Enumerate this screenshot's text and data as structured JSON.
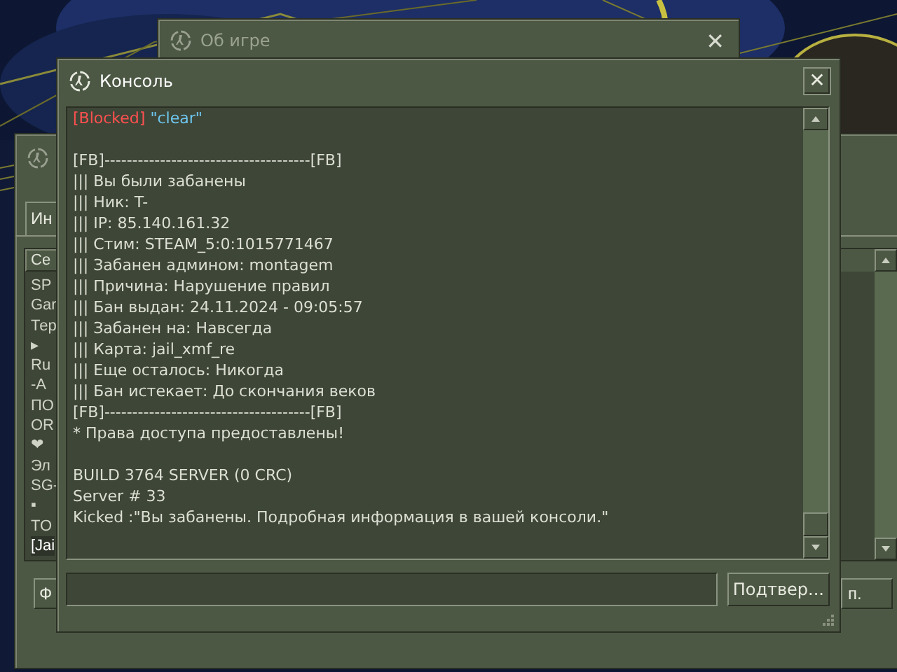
{
  "server_window": {
    "tab": "Ин",
    "column_header": "Се",
    "rows": [
      {
        "text": "SP",
        "selected": false
      },
      {
        "text": "Gar",
        "selected": false
      },
      {
        "text": "Тер",
        "selected": false
      },
      {
        "text": "▸",
        "selected": false
      },
      {
        "text": "Ru",
        "selected": false
      },
      {
        "text": "-A",
        "selected": false
      },
      {
        "text": "ПО",
        "selected": false
      },
      {
        "text": "OR",
        "selected": false
      },
      {
        "text": "❤",
        "selected": false
      },
      {
        "text": "Эл",
        "selected": false
      },
      {
        "text": "SG-",
        "selected": false
      },
      {
        "text": "▪",
        "selected": false
      },
      {
        "text": "TO",
        "selected": false
      },
      {
        "text": "[Jai",
        "selected": true
      }
    ],
    "left_button": "Ф",
    "right_button": "п."
  },
  "about_window": {
    "title": "Об игре",
    "active": false,
    "close": "✕"
  },
  "console": {
    "title": "Консоль",
    "active": true,
    "close": "✕",
    "blocks": [
      [
        [
          {
            "text": "[Blocked]",
            "color": "#ff5050"
          },
          {
            "text": " \"clear\"",
            "color": "#6ec6ee"
          }
        ]
      ],
      [
        [
          {
            "text": "[FB]-------------------------------------[FB]"
          }
        ],
        [
          {
            "text": "||| Вы были забанены"
          }
        ],
        [
          {
            "text": "||| Ник: T-"
          }
        ],
        [
          {
            "text": "||| IP: 85.140.161.32"
          }
        ],
        [
          {
            "text": "||| Стим: STEAM_5:0:1015771467"
          }
        ],
        [
          {
            "text": "||| Забанен админом: montagem"
          }
        ],
        [
          {
            "text": "||| Причина: Нарушение правил"
          }
        ],
        [
          {
            "text": "||| Бан выдан: 24.11.2024 - 09:05:57"
          }
        ],
        [
          {
            "text": "||| Забанен на: Навсегда"
          }
        ],
        [
          {
            "text": "||| Карта: jail_xmf_re"
          }
        ],
        [
          {
            "text": "||| Еще осталось: Никогда"
          }
        ],
        [
          {
            "text": "||| Бан истекает: До скончания веков"
          }
        ],
        [
          {
            "text": "[FB]-------------------------------------[FB]"
          }
        ],
        [
          {
            "text": "* Права доступа предоставлены!"
          }
        ]
      ],
      [
        [
          {
            "text": "BUILD 3764 SERVER (0 CRC)"
          }
        ],
        [
          {
            "text": "Server # 33"
          }
        ],
        [
          {
            "text": "Kicked :\"Вы забанены. Подробная информация в вашей консоли.\""
          }
        ]
      ]
    ],
    "submit_button": "Подтвер..."
  }
}
